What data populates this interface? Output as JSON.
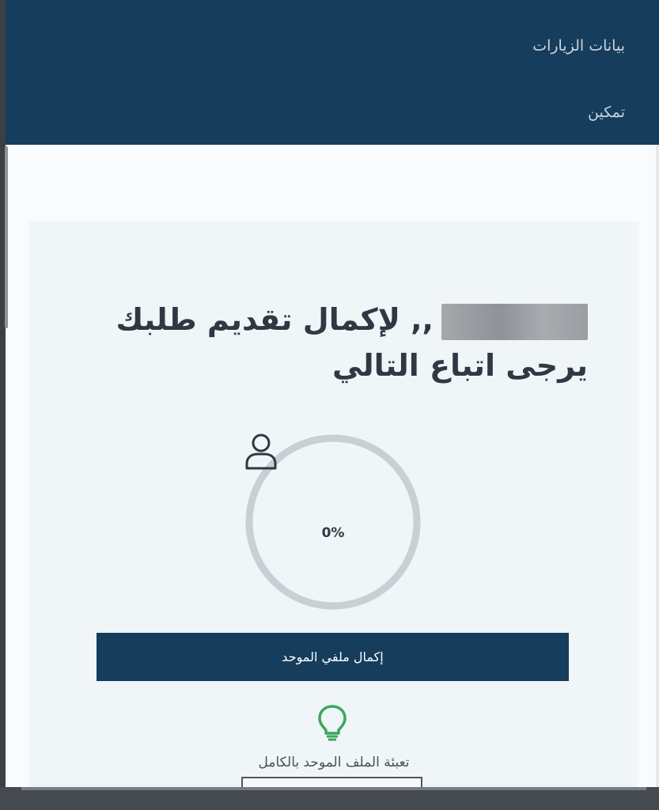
{
  "nav": {
    "visits_data_label": "بيانات الزيارات",
    "enable_label": "تمكين"
  },
  "greeting": {
    "line1_suffix": ",, لإكمال تقديم طلبك",
    "line2": "يرجى اتباع التالي"
  },
  "profile_progress": {
    "value": 0,
    "label": "0%"
  },
  "complete_profile_button_label": "إكمال ملفي الموحد",
  "tip": {
    "text": "تعبئة الملف الموحد بالكامل"
  },
  "colors": {
    "primary": "#163d5c",
    "ring": "#c7d0d4",
    "bulb": "#39a85a"
  },
  "icons": {
    "user": "user-icon",
    "bulb": "lightbulb-icon"
  }
}
